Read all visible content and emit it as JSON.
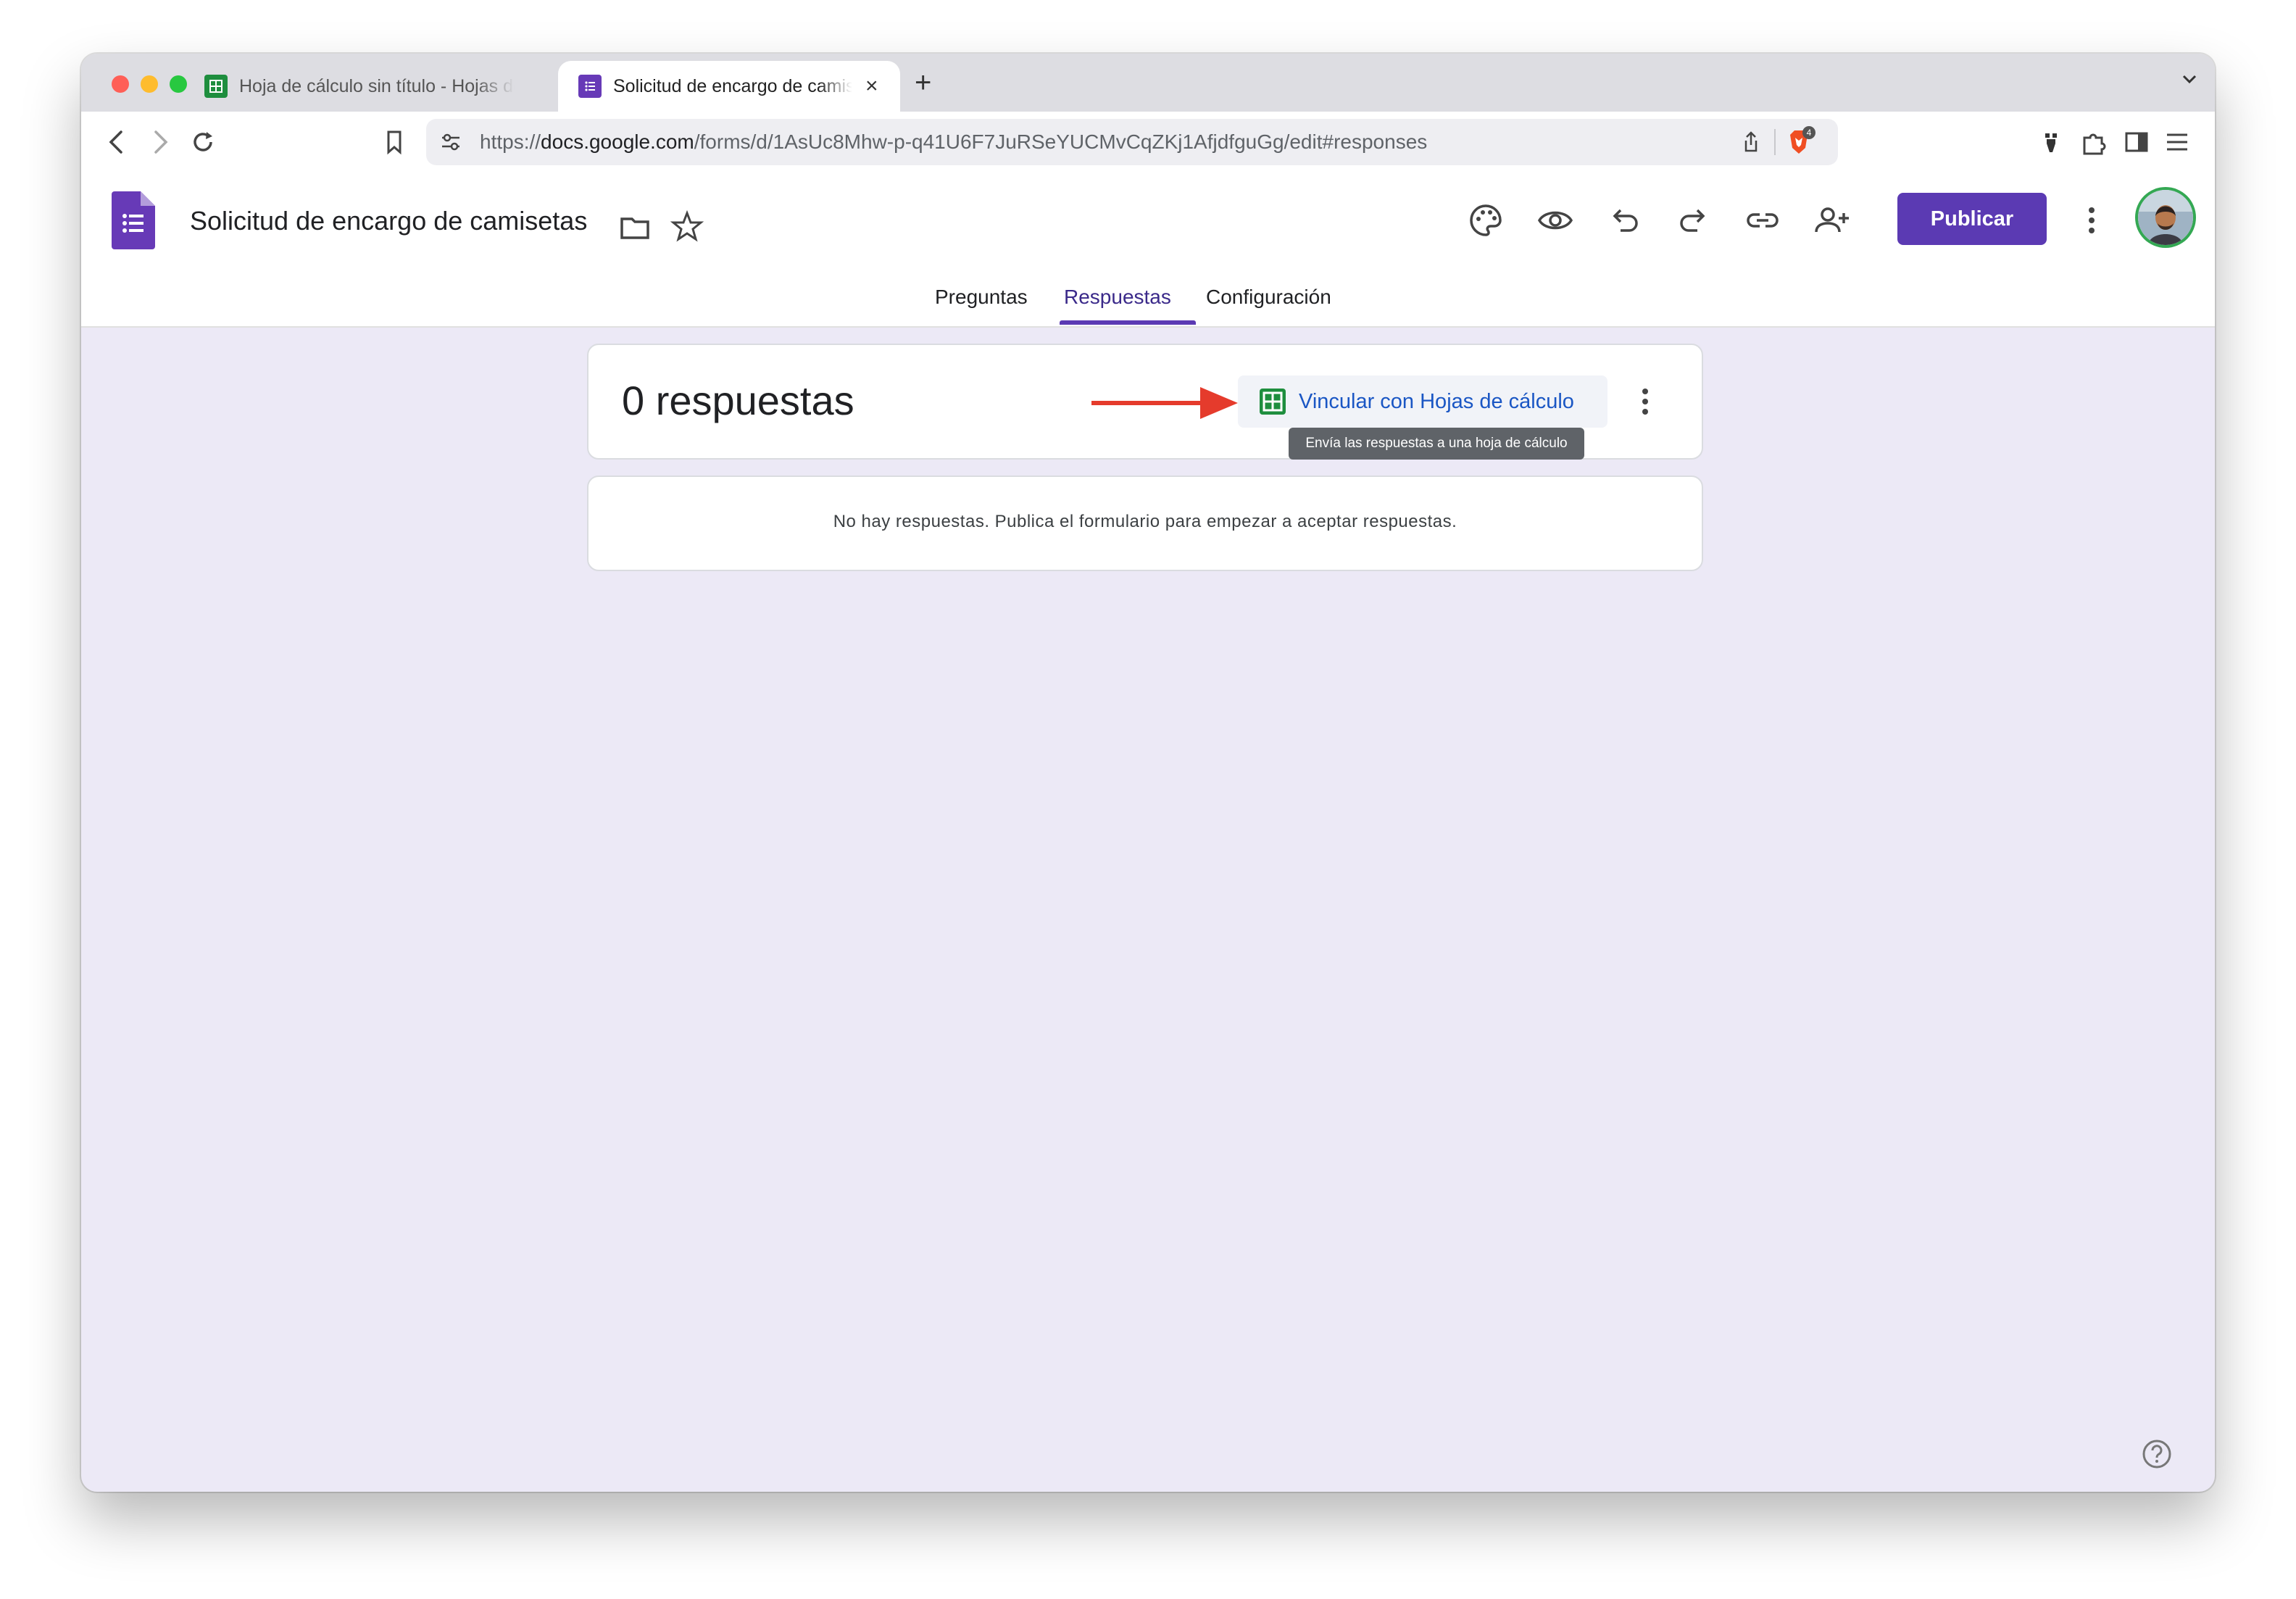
{
  "browser": {
    "tabs": [
      {
        "title": "Hoja de cálculo sin título - Hojas de cálculo de Google",
        "active": false
      },
      {
        "title": "Solicitud de encargo de camisetas",
        "active": true
      }
    ],
    "new_tab_label": "+",
    "close_tab_label": "×",
    "url_prefix": "https://",
    "url_host": "docs.google.com",
    "url_path": "/forms/d/1AsUc8Mhw-p-q41U6F7JuRSeYUCMvCqZKj1AfjdfguGg/edit#responses",
    "brave_badge": "4"
  },
  "app": {
    "title": "Solicitud de encargo de camisetas",
    "publish_label": "Publicar",
    "nav_tabs": [
      {
        "label": "Preguntas",
        "active": false
      },
      {
        "label": "Respuestas",
        "active": true
      },
      {
        "label": "Configuración",
        "active": false
      }
    ]
  },
  "responses": {
    "count_text": "0 respuestas",
    "link_sheets_label": "Vincular con Hojas de cálculo",
    "tooltip": "Envía las respuestas a una hoja de cálculo",
    "empty_message": "No hay respuestas. Publica el formulario para empezar a aceptar respuestas."
  },
  "colors": {
    "forms_purple": "#5b3ab3",
    "sheets_green": "#34a853",
    "link_blue": "#1a56c4",
    "page_bg": "#ece9f6",
    "annotation_arrow": "#e53b2c"
  },
  "icons": [
    "folder-icon",
    "star-icon",
    "palette-icon",
    "preview-eye-icon",
    "undo-icon",
    "redo-icon",
    "link-icon",
    "add-collaborator-icon",
    "more-vert-icon",
    "help-icon"
  ]
}
